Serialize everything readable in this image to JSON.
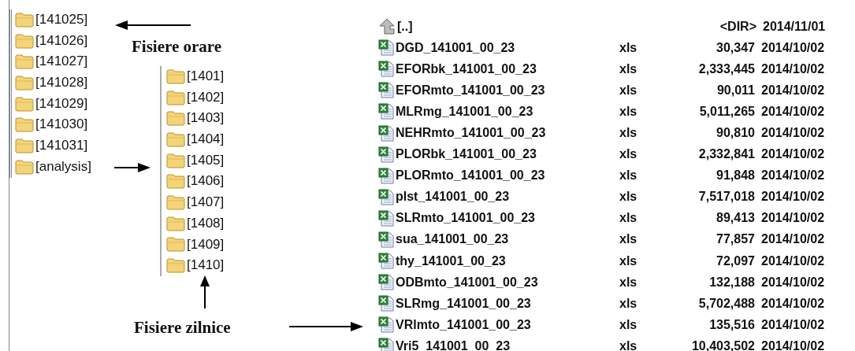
{
  "hourly_folders": [
    "[141025]",
    "[141026]",
    "[141027]",
    "[141028]",
    "[141029]",
    "[141030]",
    "[141031]",
    "[analysis]"
  ],
  "labels": {
    "hourly": "Fisiere orare",
    "daily": "Fisiere zilnice"
  },
  "daily_folders": [
    "[1401]",
    "[1402]",
    "[1403]",
    "[1404]",
    "[1405]",
    "[1406]",
    "[1407]",
    "[1408]",
    "[1409]",
    "[1410]"
  ],
  "file_list": {
    "parent": {
      "name": "[..]",
      "size": "<DIR>",
      "date": "2014/11/01"
    },
    "files": [
      {
        "name": "DGD_141001_00_23",
        "ext": "xls",
        "size": "30,347",
        "date": "2014/10/02"
      },
      {
        "name": "EFORbk_141001_00_23",
        "ext": "xls",
        "size": "2,333,445",
        "date": "2014/10/02"
      },
      {
        "name": "EFORmto_141001_00_23",
        "ext": "xls",
        "size": "90,011",
        "date": "2014/10/02"
      },
      {
        "name": "MLRmg_141001_00_23",
        "ext": "xls",
        "size": "5,011,265",
        "date": "2014/10/02"
      },
      {
        "name": "NEHRmto_141001_00_23",
        "ext": "xls",
        "size": "90,810",
        "date": "2014/10/02"
      },
      {
        "name": "PLORbk_141001_00_23",
        "ext": "xls",
        "size": "2,332,841",
        "date": "2014/10/02"
      },
      {
        "name": "PLORmto_141001_00_23",
        "ext": "xls",
        "size": "91,848",
        "date": "2014/10/02"
      },
      {
        "name": "plst_141001_00_23",
        "ext": "xls",
        "size": "7,517,018",
        "date": "2014/10/02"
      },
      {
        "name": "SLRmto_141001_00_23",
        "ext": "xls",
        "size": "89,413",
        "date": "2014/10/02"
      },
      {
        "name": "sua_141001_00_23",
        "ext": "xls",
        "size": "77,857",
        "date": "2014/10/02"
      },
      {
        "name": "thy_141001_00_23",
        "ext": "xls",
        "size": "72,097",
        "date": "2014/10/02"
      },
      {
        "name": "ODBmto_141001_00_23",
        "ext": "xls",
        "size": "132,188",
        "date": "2014/10/02"
      },
      {
        "name": "SLRmg_141001_00_23",
        "ext": "xls",
        "size": "5,702,488",
        "date": "2014/10/02"
      },
      {
        "name": "VRlmto_141001_00_23",
        "ext": "xls",
        "size": "135,516",
        "date": "2014/10/02"
      },
      {
        "name": "Vri5_141001_00_23",
        "ext": "xls",
        "size": "10,403,502",
        "date": "2014/10/02"
      }
    ]
  }
}
